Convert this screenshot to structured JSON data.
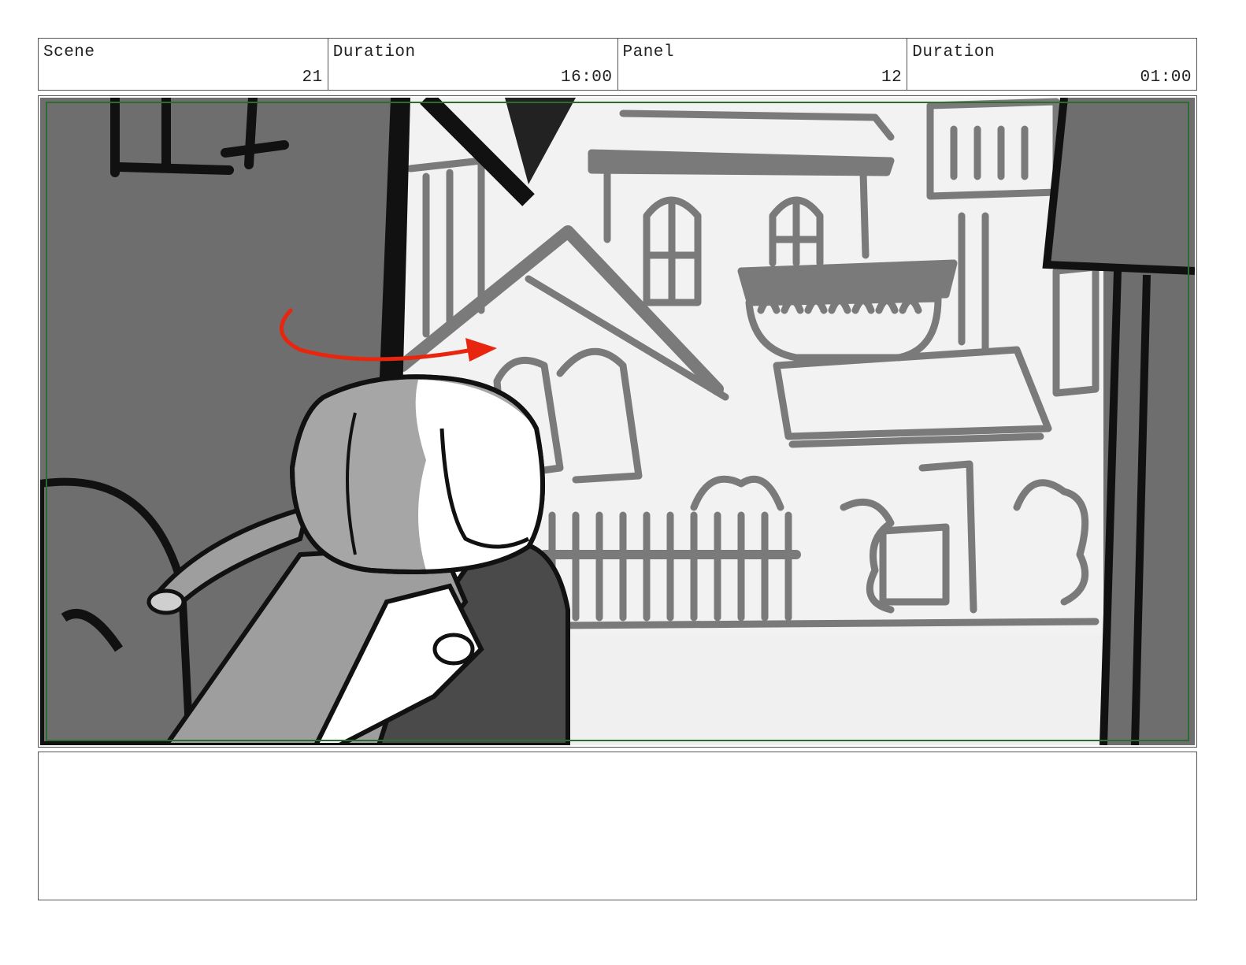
{
  "header": {
    "scene_label": "Scene",
    "scene_value": "21",
    "scene_duration_label": "Duration",
    "scene_duration_value": "16:00",
    "panel_label": "Panel",
    "panel_value": "12",
    "panel_duration_label": "Duration",
    "panel_duration_value": "01:00"
  },
  "notes": {
    "text": ""
  },
  "colors": {
    "safe_frame": "#2e6b2e",
    "motion_arrow": "#e8260f",
    "dark_wall": "#6e6e6e",
    "background_building": "#7a7a7a",
    "sky": "#f2f2f2"
  }
}
